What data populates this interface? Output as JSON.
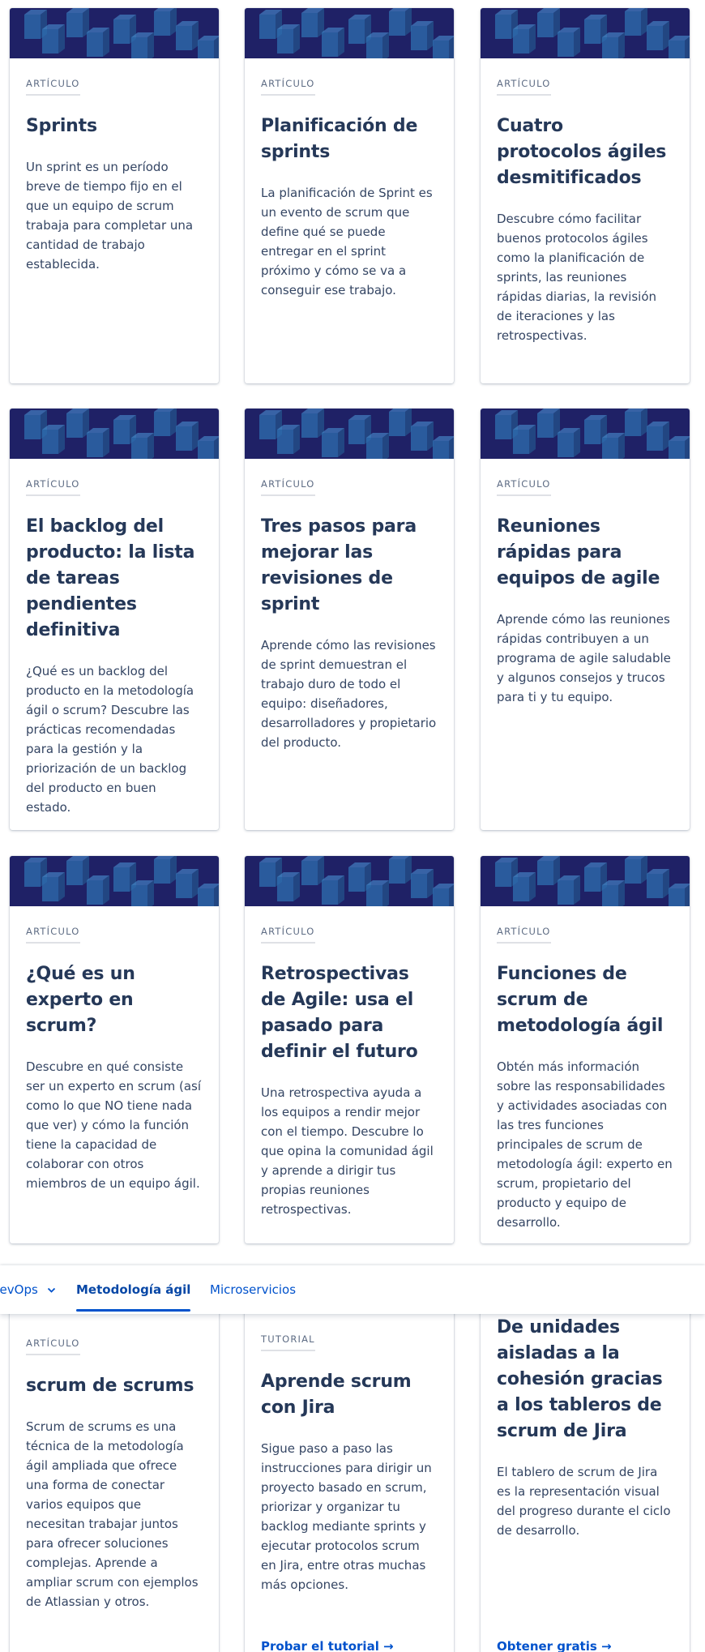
{
  "cards": [
    {
      "eyebrow": "ARTÍCULO",
      "title": "Sprints",
      "description": "Un sprint es un período breve de tiempo fijo en el que un equipo de scrum trabaja para completar una cantidad de trabajo establecida."
    },
    {
      "eyebrow": "ARTÍCULO",
      "title": "Planificación de sprints",
      "description": "La planificación de Sprint es un evento de scrum que define qué se puede entregar en el sprint próximo y cómo se va a conseguir ese trabajo."
    },
    {
      "eyebrow": "ARTÍCULO",
      "title": "Cuatro protocolos ágiles desmitificados",
      "description": "Descubre cómo facilitar buenos protocolos ágiles como la planificación de sprints, las reuniones rápidas diarias, la revisión de iteraciones y las retrospectivas."
    },
    {
      "eyebrow": "ARTÍCULO",
      "title": "El backlog del producto: la lista de tareas pendientes definitiva",
      "description": "¿Qué es un backlog del producto en la metodología ágil o scrum? Descubre las prácticas recomendadas para la gestión y la priorización de un backlog del producto en buen estado."
    },
    {
      "eyebrow": "ARTÍCULO",
      "title": "Tres pasos para mejorar las revisiones de sprint",
      "description": "Aprende cómo las revisiones de sprint demuestran el trabajo duro de todo el equipo: diseñadores, desarrolladores y propietario del producto."
    },
    {
      "eyebrow": "ARTÍCULO",
      "title": "Reuniones rápidas para equipos de agile",
      "description": "Aprende cómo las reuniones rápidas contribuyen a un programa de agile saludable y algunos consejos y trucos para ti y tu equipo."
    },
    {
      "eyebrow": "ARTÍCULO",
      "title": "¿Qué es un experto en scrum?",
      "description": "Descubre en qué consiste ser un experto en scrum (así como lo que NO tiene nada que ver) y cómo la función tiene la capacidad de colaborar con otros miembros de un equipo ágil."
    },
    {
      "eyebrow": "ARTÍCULO",
      "title": "Retrospectivas de Agile: usa el pasado para definir el futuro",
      "description": "Una retrospectiva ayuda a los equipos a rendir mejor con el tiempo. Descubre lo que opina la comunidad ágil y aprende a dirigir tus propias reuniones retrospectivas."
    },
    {
      "eyebrow": "ARTÍCULO",
      "title": "Funciones de scrum de metodología ágil",
      "description": "Obtén más información sobre las responsabilidades y actividades asociadas con las tres funciones principales de scrum de metodología ágil: experto en scrum, propietario del producto y equipo de desarrollo."
    },
    {
      "eyebrow": "ARTÍCULO",
      "title": "scrum de scrums",
      "description": "Scrum de scrums es una técnica de la metodología ágil ampliada que ofrece una forma de conectar varios equipos que necesitan trabajar juntos para ofrecer soluciones complejas. Aprende a ampliar scrum con ejemplos de Atlassian y otros."
    },
    {
      "eyebrow": "TUTORIAL",
      "title": "Aprende scrum con Jira",
      "description": "Sigue paso a paso las instrucciones para dirigir un proyecto basado en scrum, priorizar y organizar tu backlog mediante sprints y ejecutar protocolos scrum en Jira, entre otras muchas más opciones.",
      "cta": "Probar el tutorial →"
    },
    {
      "title": "De unidades aisladas a la cohesión gracias a los tableros de scrum de Jira",
      "description": "El tablero de scrum de Jira es la representación visual del progreso durante el ciclo de desarrollo.",
      "cta": "Obtener gratis →"
    }
  ],
  "subnav": {
    "items": [
      {
        "label": "DevOps",
        "icon": "chevron-down-icon"
      },
      {
        "label": "Metodología ágil",
        "active": true
      },
      {
        "label": "Microservicios"
      }
    ]
  },
  "colors": {
    "banner": "#1f2166",
    "cube": "#2f6fb0",
    "link": "#0052cc",
    "active_tab": "#0747a6"
  }
}
